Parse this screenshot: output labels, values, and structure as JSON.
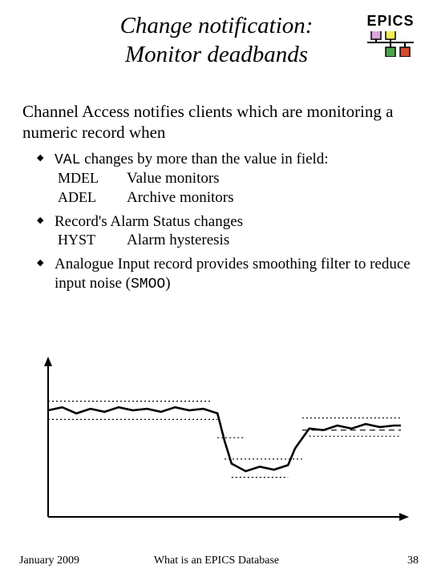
{
  "title_line1": "Change notification:",
  "title_line2": "Monitor deadbands",
  "logo_text": "EPICS",
  "intro": "Channel Access notifies clients which are monitoring a numeric record when",
  "bullets": [
    {
      "lead_mono": "VAL",
      "lead_rest": " changes by more than the value in field:",
      "rows": [
        {
          "k": "MDEL",
          "v": "Value monitors"
        },
        {
          "k": "ADEL",
          "v": "Archive monitors"
        }
      ]
    },
    {
      "lead": "Record's Alarm Status changes",
      "rows": [
        {
          "k": "HYST",
          "v": "Alarm hysteresis"
        }
      ]
    },
    {
      "lead_pre": "Analogue Input record provides smoothing filter to reduce input noise (",
      "lead_mono": "SMOO",
      "lead_post": ")"
    }
  ],
  "footer": {
    "left": "January 2009",
    "center": "What is an EPICS Database",
    "right": "38"
  },
  "chart_data": {
    "type": "line",
    "title": "",
    "xlabel": "",
    "ylabel": "",
    "xlim": [
      0,
      100
    ],
    "ylim": [
      0,
      100
    ],
    "series": [
      {
        "name": "signal",
        "style": "solid-thick",
        "x": [
          0,
          4,
          8,
          12,
          16,
          20,
          24,
          28,
          32,
          36,
          40,
          44,
          48,
          50,
          52,
          56,
          60,
          64,
          68,
          70,
          74,
          78,
          82,
          86,
          90,
          94,
          98,
          100
        ],
        "y": [
          70,
          72,
          68,
          71,
          69,
          72,
          70,
          71,
          69,
          72,
          70,
          71,
          68,
          50,
          35,
          30,
          33,
          31,
          34,
          45,
          58,
          57,
          60,
          58,
          61,
          59,
          60,
          60
        ]
      },
      {
        "name": "upper-band-high",
        "style": "dash-short",
        "x": [
          0,
          46
        ],
        "y": [
          76,
          76
        ]
      },
      {
        "name": "lower-band-high",
        "style": "dash-short",
        "x": [
          0,
          48
        ],
        "y": [
          64,
          64
        ]
      },
      {
        "name": "mid-tick",
        "style": "dash-short",
        "x": [
          48,
          56
        ],
        "y": [
          52,
          52
        ]
      },
      {
        "name": "upper-band-low",
        "style": "dash-short",
        "x": [
          50,
          72
        ],
        "y": [
          38,
          38
        ]
      },
      {
        "name": "lower-band-low",
        "style": "dash-short",
        "x": [
          52,
          68
        ],
        "y": [
          26,
          26
        ]
      },
      {
        "name": "upper-band-right",
        "style": "dash-short",
        "x": [
          72,
          100
        ],
        "y": [
          65,
          65
        ]
      },
      {
        "name": "lower-band-right",
        "style": "dash-short",
        "x": [
          74,
          100
        ],
        "y": [
          53,
          53
        ]
      },
      {
        "name": "report-level-right",
        "style": "dash-long",
        "x": [
          72,
          100
        ],
        "y": [
          57,
          57
        ]
      }
    ]
  }
}
